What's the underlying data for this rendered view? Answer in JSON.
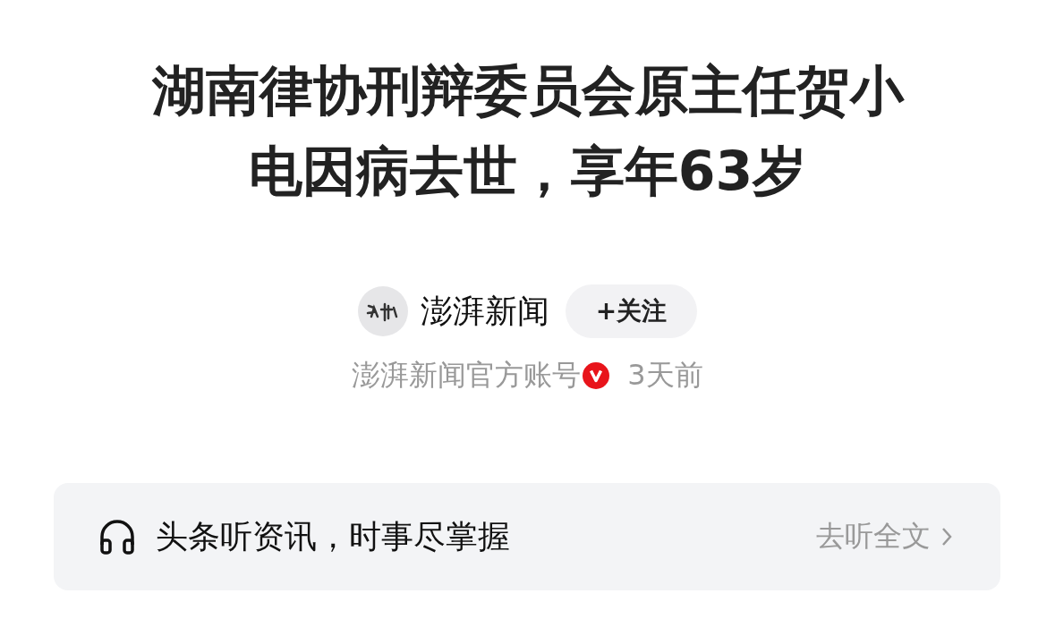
{
  "article": {
    "title": "湖南律协刑辩委员会原主任贺小电因病去世，享年63岁"
  },
  "author": {
    "name": "澎湃新闻",
    "follow_button": "+关注",
    "description": "澎湃新闻官方账号",
    "verified": true,
    "time": "3天前"
  },
  "audio_banner": {
    "text": "头条听资讯，时事尽掌握",
    "action": "去听全文"
  }
}
